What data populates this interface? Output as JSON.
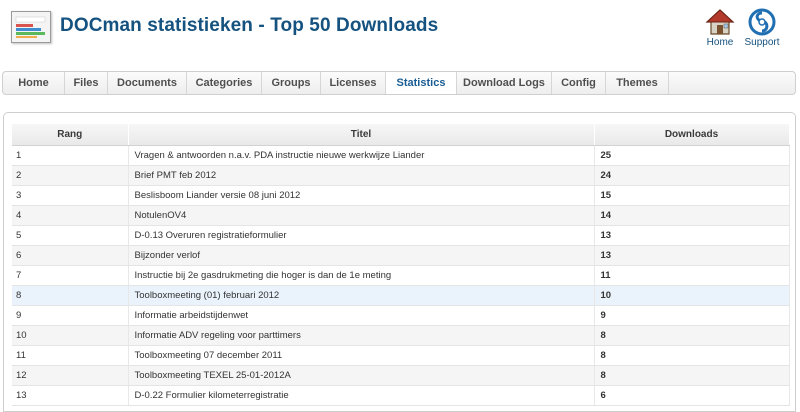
{
  "header": {
    "title": "DOCman statistieken - Top 50 Downloads",
    "logo_icon": "statistics-logo-icon",
    "home_label": "Home",
    "support_label": "Support"
  },
  "tabs": [
    {
      "label": "Home"
    },
    {
      "label": "Files"
    },
    {
      "label": "Documents"
    },
    {
      "label": "Categories"
    },
    {
      "label": "Groups"
    },
    {
      "label": "Licenses"
    },
    {
      "label": "Statistics",
      "active": true
    },
    {
      "label": "Download Logs"
    },
    {
      "label": "Config"
    },
    {
      "label": "Themes"
    }
  ],
  "table": {
    "headers": {
      "rank": "Rang",
      "title": "Titel",
      "downloads": "Downloads"
    },
    "rows": [
      {
        "rank": "1",
        "title": "Vragen & antwoorden n.a.v. PDA instructie nieuwe werkwijze Liander",
        "downloads": "25"
      },
      {
        "rank": "2",
        "title": "Brief PMT feb 2012",
        "downloads": "24"
      },
      {
        "rank": "3",
        "title": "Beslisboom Liander versie 08 juni 2012",
        "downloads": "15"
      },
      {
        "rank": "4",
        "title": "NotulenOV4",
        "downloads": "14"
      },
      {
        "rank": "5",
        "title": "D-0.13 Overuren registratieformulier",
        "downloads": "13"
      },
      {
        "rank": "6",
        "title": "Bijzonder verlof",
        "downloads": "13"
      },
      {
        "rank": "7",
        "title": "Instructie bij 2e gasdrukmeting die hoger is dan de 1e meting",
        "downloads": "11"
      },
      {
        "rank": "8",
        "title": "Toolboxmeeting (01) februari 2012",
        "downloads": "10"
      },
      {
        "rank": "9",
        "title": "Informatie arbeidstijdenwet",
        "downloads": "9"
      },
      {
        "rank": "10",
        "title": "Informatie ADV regeling voor parttimers",
        "downloads": "8"
      },
      {
        "rank": "11",
        "title": "Toolboxmeeting 07 december 2011",
        "downloads": "8"
      },
      {
        "rank": "12",
        "title": "Toolboxmeeting TEXEL 25-01-2012A",
        "downloads": "8"
      },
      {
        "rank": "13",
        "title": "D-0.22 Formulier kilometerregistratie",
        "downloads": "6"
      }
    ]
  },
  "colors": {
    "title": "#15527f",
    "active_tab": "#1a5d94",
    "highlight_row": "#eaf3fb"
  }
}
